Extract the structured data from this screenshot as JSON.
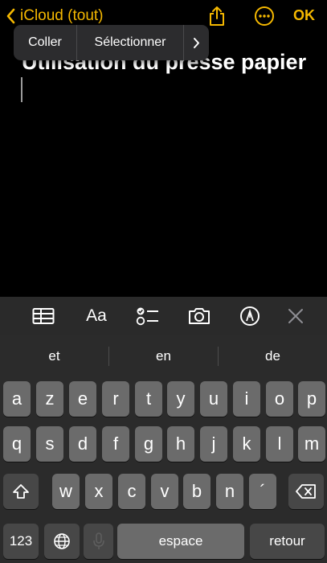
{
  "nav": {
    "back_label": "iCloud (tout)",
    "back_icon": "chevron-left-icon",
    "share_icon": "share-icon",
    "more_icon": "ellipsis-circle-icon",
    "done_label": "OK",
    "accent_color": "#f5b800"
  },
  "note": {
    "title": "Utilisation du presse papier"
  },
  "edit_menu": {
    "paste_label": "Coller",
    "select_label": "Sélectionner",
    "next_icon": "chevron-right-icon"
  },
  "toolbar": {
    "table_icon": "table-icon",
    "format_label": "Aa",
    "checklist_icon": "checklist-icon",
    "camera_icon": "camera-icon",
    "markup_icon": "markup-pen-icon",
    "close_icon": "close-icon"
  },
  "keyboard": {
    "suggestions": [
      "et",
      "en",
      "de"
    ],
    "row1": [
      "a",
      "z",
      "e",
      "r",
      "t",
      "y",
      "u",
      "i",
      "o",
      "p"
    ],
    "row2": [
      "q",
      "s",
      "d",
      "f",
      "g",
      "h",
      "j",
      "k",
      "l",
      "m"
    ],
    "row3": [
      "w",
      "x",
      "c",
      "v",
      "b",
      "n",
      "´"
    ],
    "numbers_label": "123",
    "space_label": "espace",
    "return_label": "retour"
  }
}
